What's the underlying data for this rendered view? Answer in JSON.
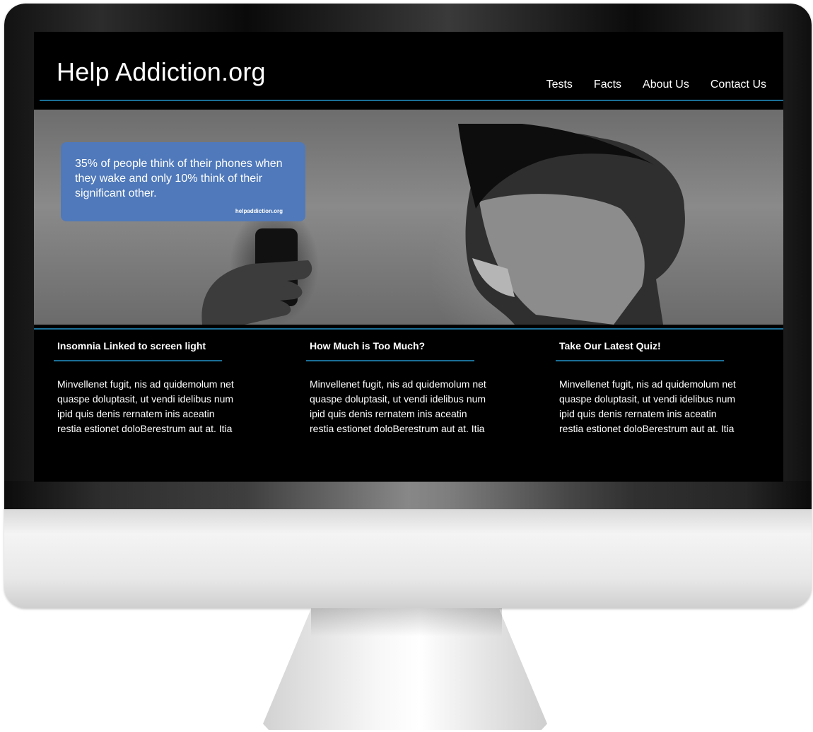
{
  "site": {
    "logo": "Help Addiction.org",
    "nav": [
      "Tests",
      "Facts",
      "About Us",
      "Contact Us"
    ]
  },
  "hero": {
    "callout_text": "35% of people think of their phones when they wake and only 10% think of their significant other.",
    "callout_source": "helpaddiction.org",
    "callout_color": "#4f79ba"
  },
  "columns": [
    {
      "title": "Insomnia Linked to screen light",
      "body": "Minvellenet fugit, nis ad quidemolum net quaspe doluptasit, ut vendi idelibus num ipid quis denis rernatem inis aceatin restia estionet doloBerestrum aut at. Itia"
    },
    {
      "title": "How Much is Too Much?",
      "body": "Minvellenet fugit, nis ad quidemolum net quaspe doluptasit, ut vendi idelibus num ipid quis denis rernatem inis aceatin restia estionet doloBerestrum aut at. Itia"
    },
    {
      "title": "Take Our Latest Quiz!",
      "body": "Minvellenet fugit, nis ad quidemolum net quaspe doluptasit, ut vendi idelibus num ipid quis denis rernatem inis aceatin restia estionet doloBerestrum aut at. Itia"
    }
  ],
  "colors": {
    "accent_rule": "#1b6f97",
    "page_background": "#000000"
  }
}
